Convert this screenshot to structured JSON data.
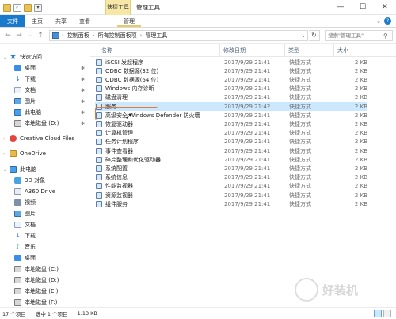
{
  "titlebar": {
    "context_tab": "快捷工具",
    "title": "管理工具",
    "minimize": "—",
    "maximize": "☐",
    "close": "✕"
  },
  "ribbon": {
    "tabs": [
      "文件",
      "主页",
      "共享",
      "查看",
      "管理"
    ]
  },
  "address": {
    "crumbs": [
      "控制面板",
      "所有控制面板项",
      "管理工具"
    ],
    "search_placeholder": "搜索\"管理工具\""
  },
  "nav": {
    "quick_access": "快速访问",
    "quick_items": [
      "桌面",
      "下载",
      "文档",
      "图片",
      "此电脑",
      "本地磁盘 (D:)"
    ],
    "creative_cloud": "Creative Cloud Files",
    "onedrive": "OneDrive",
    "this_pc": "此电脑",
    "pc_items": [
      "3D 对象",
      "A360 Drive",
      "视频",
      "图片",
      "文档",
      "下载",
      "音乐",
      "桌面",
      "本地磁盘 (C:)",
      "本地磁盘 (D:)",
      "本地磁盘 (E:)",
      "本地磁盘 (F:)"
    ]
  },
  "columns": {
    "name": "名称",
    "date": "修改日期",
    "type": "类型",
    "size": "大小"
  },
  "files": [
    {
      "name": "iSCSI 发起程序",
      "date": "2017/9/29 21:41",
      "type": "快捷方式",
      "size": "2 KB"
    },
    {
      "name": "ODBC 数据源(32 位)",
      "date": "2017/9/29 21:41",
      "type": "快捷方式",
      "size": "2 KB"
    },
    {
      "name": "ODBC 数据源(64 位)",
      "date": "2017/9/29 21:41",
      "type": "快捷方式",
      "size": "2 KB"
    },
    {
      "name": "Windows 内存诊断",
      "date": "2017/9/29 21:41",
      "type": "快捷方式",
      "size": "2 KB"
    },
    {
      "name": "磁盘清理",
      "date": "2017/9/29 21:41",
      "type": "快捷方式",
      "size": "2 KB"
    },
    {
      "name": "服务",
      "date": "2017/9/29 21:42",
      "type": "快捷方式",
      "size": "2 KB"
    },
    {
      "name": "高级安全 Windows Defender 防火墙",
      "date": "2017/9/29 21:41",
      "type": "快捷方式",
      "size": "2 KB"
    },
    {
      "name": "恢复驱动器",
      "date": "2017/9/29 21:41",
      "type": "快捷方式",
      "size": "2 KB"
    },
    {
      "name": "计算机管理",
      "date": "2017/9/29 21:41",
      "type": "快捷方式",
      "size": "2 KB"
    },
    {
      "name": "任务计划程序",
      "date": "2017/9/29 21:41",
      "type": "快捷方式",
      "size": "2 KB"
    },
    {
      "name": "事件查看器",
      "date": "2017/9/29 21:41",
      "type": "快捷方式",
      "size": "2 KB"
    },
    {
      "name": "碎片整理和优化驱动器",
      "date": "2017/9/29 21:41",
      "type": "快捷方式",
      "size": "2 KB"
    },
    {
      "name": "系统配置",
      "date": "2017/9/29 21:41",
      "type": "快捷方式",
      "size": "2 KB"
    },
    {
      "name": "系统信息",
      "date": "2017/9/29 21:41",
      "type": "快捷方式",
      "size": "2 KB"
    },
    {
      "name": "性能监视器",
      "date": "2017/9/29 21:41",
      "type": "快捷方式",
      "size": "2 KB"
    },
    {
      "name": "资源监视器",
      "date": "2017/9/29 21:41",
      "type": "快捷方式",
      "size": "2 KB"
    },
    {
      "name": "组件服务",
      "date": "2017/9/29 21:41",
      "type": "快捷方式",
      "size": "2 KB"
    }
  ],
  "selected_index": 5,
  "status": {
    "count": "17 个项目",
    "selected": "选中 1 个项目",
    "size": "1.13 KB"
  },
  "watermark": "好装机",
  "colors": {
    "file_tab": "#1979ca",
    "selection": "#cce8ff",
    "highlight_box": "#e57b37",
    "context_tab": "#f7e7a6"
  }
}
